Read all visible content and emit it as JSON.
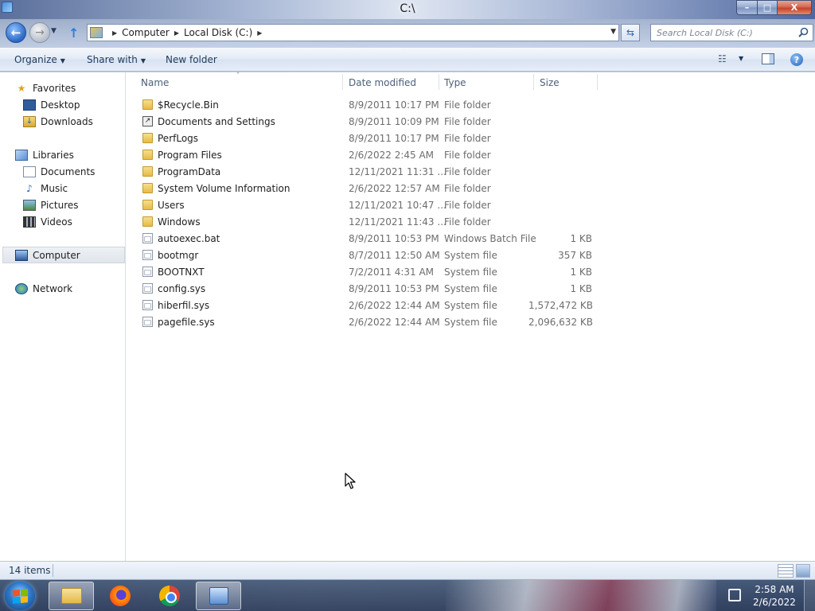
{
  "window": {
    "title": "C:\\",
    "caption_buttons": {
      "minimize": "–",
      "maximize": "□",
      "close": "X"
    }
  },
  "address": {
    "crumbs": [
      "Computer",
      "Local Disk (C:)"
    ],
    "search_placeholder": "Search Local Disk (C:)"
  },
  "toolbar": {
    "organize": "Organize",
    "share_with": "Share with",
    "new_folder": "New folder"
  },
  "nav": {
    "favorites": "Favorites",
    "desktop": "Desktop",
    "downloads": "Downloads",
    "libraries": "Libraries",
    "documents": "Documents",
    "music": "Music",
    "pictures": "Pictures",
    "videos": "Videos",
    "computer": "Computer",
    "network": "Network"
  },
  "columns": {
    "name": "Name",
    "date_modified": "Date modified",
    "type": "Type",
    "size": "Size"
  },
  "files": [
    {
      "name": "$Recycle.Bin",
      "date": "8/9/2011 10:17 PM",
      "type": "File folder",
      "size": "",
      "icon": "folder-icon"
    },
    {
      "name": "Documents and Settings",
      "date": "8/9/2011 10:09 PM",
      "type": "File folder",
      "size": "",
      "icon": "shortcut-folder-icon"
    },
    {
      "name": "PerfLogs",
      "date": "8/9/2011 10:17 PM",
      "type": "File folder",
      "size": "",
      "icon": "folder-icon"
    },
    {
      "name": "Program Files",
      "date": "2/6/2022 2:45 AM",
      "type": "File folder",
      "size": "",
      "icon": "folder-icon"
    },
    {
      "name": "ProgramData",
      "date": "12/11/2021 11:31 ...",
      "type": "File folder",
      "size": "",
      "icon": "folder-icon"
    },
    {
      "name": "System Volume Information",
      "date": "2/6/2022 12:57 AM",
      "type": "File folder",
      "size": "",
      "icon": "folder-icon"
    },
    {
      "name": "Users",
      "date": "12/11/2021 10:47 ...",
      "type": "File folder",
      "size": "",
      "icon": "folder-icon"
    },
    {
      "name": "Windows",
      "date": "12/11/2021 11:43 ...",
      "type": "File folder",
      "size": "",
      "icon": "folder-icon"
    },
    {
      "name": "autoexec.bat",
      "date": "8/9/2011 10:53 PM",
      "type": "Windows Batch File",
      "size": "1 KB",
      "icon": "batch-file-icon"
    },
    {
      "name": "bootmgr",
      "date": "8/7/2011 12:50 AM",
      "type": "System file",
      "size": "357 KB",
      "icon": "system-file-icon"
    },
    {
      "name": "BOOTNXT",
      "date": "7/2/2011 4:31 AM",
      "type": "System file",
      "size": "1 KB",
      "icon": "system-file-icon"
    },
    {
      "name": "config.sys",
      "date": "8/9/2011 10:53 PM",
      "type": "System file",
      "size": "1 KB",
      "icon": "system-file-icon"
    },
    {
      "name": "hiberfil.sys",
      "date": "2/6/2022 12:44 AM",
      "type": "System file",
      "size": "1,572,472 KB",
      "icon": "system-file-icon"
    },
    {
      "name": "pagefile.sys",
      "date": "2/6/2022 12:44 AM",
      "type": "System file",
      "size": "2,096,632 KB",
      "icon": "system-file-icon"
    }
  ],
  "status": {
    "item_count": "14 items"
  },
  "taskbar": {
    "apps": [
      "windows-explorer-icon",
      "firefox-icon",
      "chrome-icon",
      "network-app-icon"
    ],
    "clock_time": "2:58 AM",
    "clock_date": "2/6/2022"
  },
  "colors": {
    "accent": "#1e395b",
    "selection": "#e0e5ec",
    "folder": "#e7bb45"
  }
}
